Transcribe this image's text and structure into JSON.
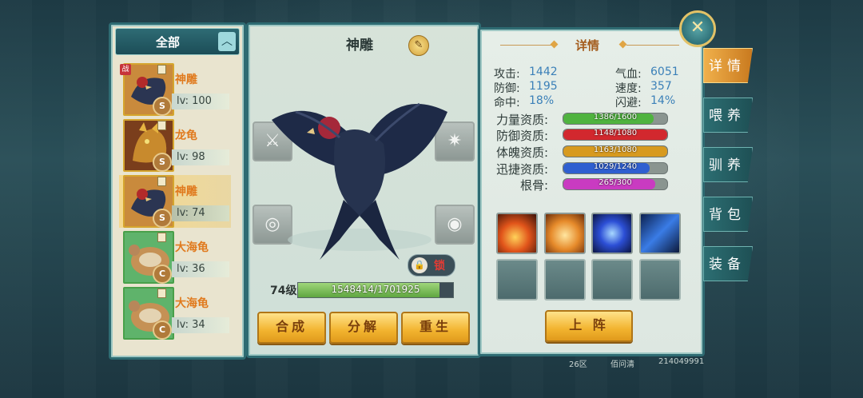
{
  "left_panel": {
    "filter_label": "全部",
    "collapse_icon": "chevron-up",
    "pets": [
      {
        "name": "神雕",
        "level": "lv: 100",
        "grade": "S",
        "kind": "eagle",
        "in_battle": true,
        "battle_badge": "战",
        "selected": false
      },
      {
        "name": "龙龟",
        "level": "lv: 98",
        "grade": "S",
        "kind": "dragon-turtle",
        "in_battle": false,
        "selected": false
      },
      {
        "name": "神雕",
        "level": "lv: 74",
        "grade": "S",
        "kind": "eagle",
        "in_battle": false,
        "selected": true
      },
      {
        "name": "大海龟",
        "level": "lv: 36",
        "grade": "C",
        "kind": "turtle",
        "in_battle": false,
        "selected": false
      },
      {
        "name": "大海龟",
        "level": "lv: 34",
        "grade": "C",
        "kind": "turtle",
        "in_battle": false,
        "selected": false
      }
    ]
  },
  "center_panel": {
    "pet_name": "神雕",
    "edit_icon": "pencil-icon",
    "lock_label": "锁",
    "level_label": "74级",
    "exp_text": "1548414/1701925",
    "exp_fraction": 0.91,
    "buttons": {
      "merge": "合成",
      "decompose": "分解",
      "reborn": "重生"
    }
  },
  "detail_panel": {
    "title": "详情",
    "stats": [
      {
        "label": "攻击:",
        "value": "1442"
      },
      {
        "label": "气血:",
        "value": "6051"
      },
      {
        "label": "防御:",
        "value": "1195"
      },
      {
        "label": "速度:",
        "value": "357"
      },
      {
        "label": "命中:",
        "value": "18%"
      },
      {
        "label": "闪避:",
        "value": "14%"
      }
    ],
    "aptitudes": [
      {
        "label": "力量资质:",
        "text": "1386/1600",
        "fraction": 0.866,
        "color": "#4fb33f"
      },
      {
        "label": "防御资质:",
        "text": "1148/1080",
        "fraction": 1.0,
        "color": "#d2282e"
      },
      {
        "label": "体魄资质:",
        "text": "1163/1080",
        "fraction": 1.0,
        "color": "#d79a1f"
      },
      {
        "label": "迅捷资质:",
        "text": "1029/1240",
        "fraction": 0.83,
        "color": "#2f5fd0"
      },
      {
        "label": "根骨:",
        "text": "265/300",
        "fraction": 0.883,
        "color": "#c93bc1"
      }
    ],
    "skills": [
      {
        "icon": "fire-phoenix-skill-icon",
        "empty": false
      },
      {
        "icon": "flame-beast-skill-icon",
        "empty": false
      },
      {
        "icon": "whirlwind-skill-icon",
        "empty": false
      },
      {
        "icon": "lightning-skill-icon",
        "empty": false
      },
      {
        "icon": "empty-slot-icon",
        "empty": true
      },
      {
        "icon": "empty-slot-icon",
        "empty": true
      },
      {
        "icon": "empty-slot-icon",
        "empty": true
      },
      {
        "icon": "empty-slot-icon",
        "empty": true
      }
    ],
    "deploy_label": "上 阵"
  },
  "side_tabs": [
    "详情",
    "喂养",
    "驯养",
    "背包",
    "装备"
  ],
  "active_tab": 0,
  "footer": {
    "server": "26区",
    "player": "佰问清",
    "id": "214049991"
  }
}
